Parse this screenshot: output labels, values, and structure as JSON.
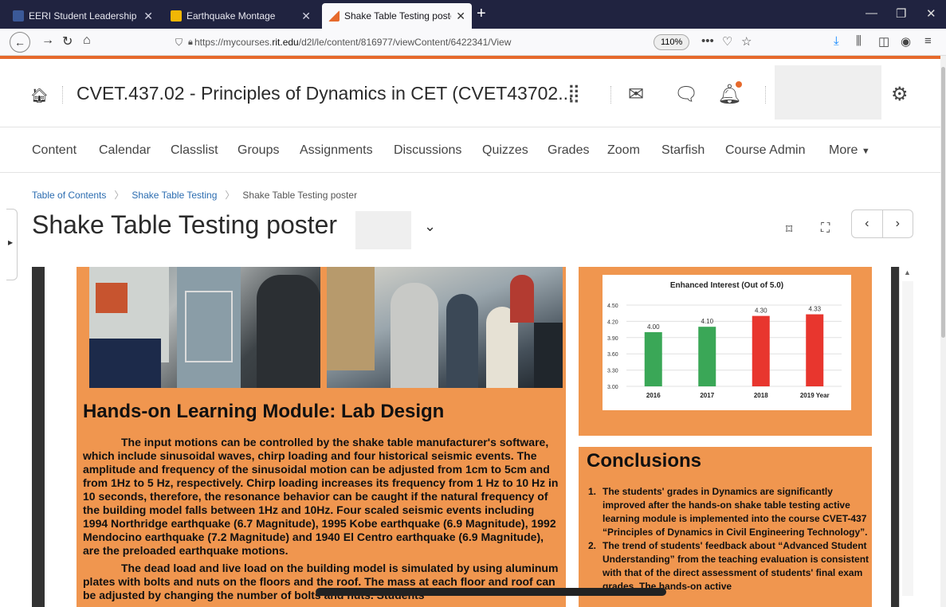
{
  "browser": {
    "tabs": [
      {
        "label": "EERI Student Leadership Counc",
        "active": false,
        "favicon_color": "#3b5998"
      },
      {
        "label": "Earthquake Montage",
        "active": false,
        "favicon_color": "#f2b705"
      },
      {
        "label": "Shake Table Testing poster-Bac",
        "active": true,
        "favicon_color": "#e66a2c"
      }
    ],
    "url_prefix": "https://mycourses.",
    "url_domain": "rit.edu",
    "url_path": "/d2l/le/content/816977/viewContent/6422341/View",
    "zoom": "110%"
  },
  "course": {
    "title": "CVET.437.02 - Principles of Dynamics in CET (CVET43702..."
  },
  "nav": {
    "items": [
      "Content",
      "Calendar",
      "Classlist",
      "Groups",
      "Assignments",
      "Discussions",
      "Quizzes",
      "Grades",
      "Zoom",
      "Starfish",
      "Course Admin",
      "More"
    ]
  },
  "breadcrumb": {
    "items": [
      "Table of Contents",
      "Shake Table Testing",
      "Shake Table Testing poster"
    ]
  },
  "page": {
    "title": "Shake Table Testing poster"
  },
  "poster": {
    "section_title": "Hands-on Learning Module: Lab Design",
    "para1": "The input motions can be controlled by the shake table manufacturer's software, which include sinusoidal waves, chirp loading and four historical seismic events. The amplitude and frequency of the sinusoidal motion can be adjusted from 1cm to 5cm and from 1Hz to 5 Hz, respectively. Chirp loading increases its frequency from 1 Hz to 10 Hz in 10 seconds, therefore, the resonance behavior can be caught if the natural frequency of the building model falls between 1Hz and 10Hz. Four scaled seismic events including 1994 Northridge earthquake (6.7 Magnitude), 1995 Kobe earthquake (6.9 Magnitude), 1992 Mendocino earthquake (7.2 Magnitude) and 1940 El Centro earthquake (6.9 Magnitude), are the preloaded earthquake motions.",
    "para2": "The dead load and live load on the building model is simulated by using aluminum plates with bolts and nuts on the floors and the roof. The mass at each floor and roof can be adjusted by changing the number of bolts and nuts. Students",
    "conclusions_title": "Conclusions",
    "conclusions": [
      {
        "num": "1.",
        "text": "The students' grades in Dynamics are significantly improved after the hands-on shake table testing active learning module is implemented into the course CVET-437 “Principles of Dynamics in Civil Engineering Technology”."
      },
      {
        "num": "2.",
        "text": "The trend of students' feedback about “Advanced Student Understanding” from the teaching evaluation is consistent with that of the direct assessment of students' final exam grades. The hands-on active"
      }
    ]
  },
  "chart_data": {
    "type": "bar",
    "title": "Enhanced Interest (Out of 5.0)",
    "categories": [
      "2016",
      "2017",
      "2018",
      "2019 Year"
    ],
    "values": [
      4.0,
      4.1,
      4.3,
      4.33
    ],
    "value_labels": [
      "4.00",
      "4.10",
      "4.30",
      "4.33"
    ],
    "bar_colors": [
      "#3aa757",
      "#3aa757",
      "#e8362e",
      "#e8362e"
    ],
    "ylim": [
      3.0,
      4.5
    ],
    "yticks": [
      "4.50",
      "4.20",
      "3.90",
      "3.60",
      "3.30",
      "3.00"
    ],
    "ytick_values": [
      4.5,
      4.2,
      3.9,
      3.6,
      3.3,
      3.0
    ],
    "grid": true
  },
  "colors": {
    "accent": "#e66a2c",
    "poster_orange": "#f0964f",
    "link": "#2b6cb0"
  }
}
